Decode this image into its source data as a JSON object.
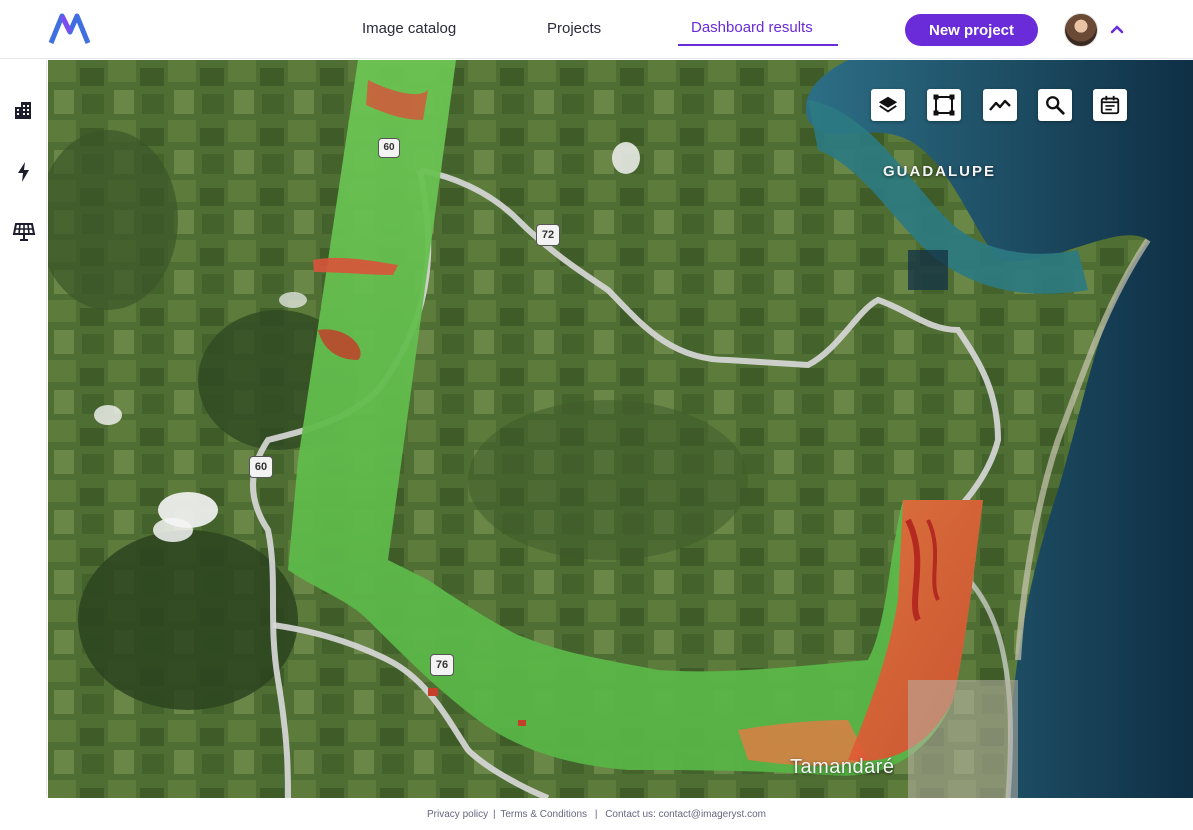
{
  "header": {
    "nav": [
      {
        "label": "Image catalog"
      },
      {
        "label": "Projects"
      },
      {
        "label": "Dashboard results",
        "active": true
      }
    ],
    "new_project_label": "New project"
  },
  "sidebar": {
    "items": [
      {
        "icon": "buildings-icon"
      },
      {
        "icon": "lightning-icon"
      },
      {
        "icon": "solar-panel-icon"
      }
    ]
  },
  "map": {
    "labels": {
      "guadalupe": "GUADALUPE",
      "tamandare": "Tamandaré"
    },
    "road_shields": [
      "60",
      "72",
      "60",
      "76"
    ],
    "toolbar": [
      {
        "icon": "layers-icon"
      },
      {
        "icon": "draw-polygon-icon"
      },
      {
        "icon": "trend-chart-icon"
      },
      {
        "icon": "search-icon"
      },
      {
        "icon": "calendar-icon"
      }
    ]
  },
  "footer": {
    "privacy": "Privacy policy",
    "sep1": "|",
    "terms": "Terms & Conditions",
    "sep2": "|",
    "contact": "Contact us: contact@imageryst.com"
  },
  "colors": {
    "accent": "#6a2bd9",
    "vegetation_green": "#5fbf4a",
    "stress_red": "#d9442f",
    "sea": "#1a4f66"
  }
}
